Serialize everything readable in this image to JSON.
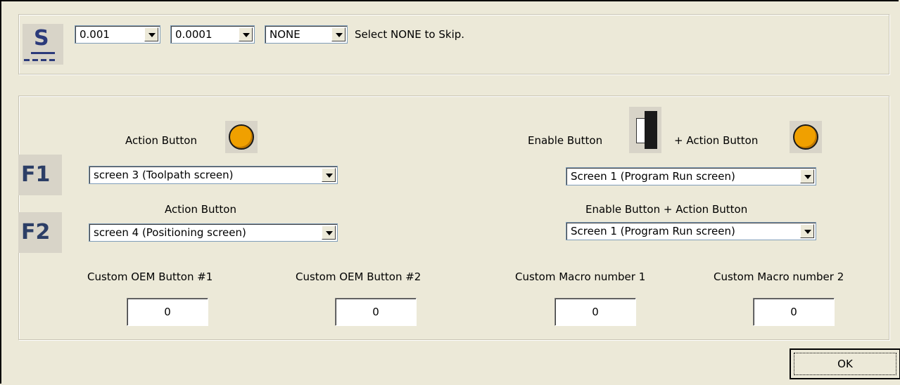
{
  "top_section": {
    "combo1": {
      "value": "0.001"
    },
    "combo2": {
      "value": "0.0001"
    },
    "combo3": {
      "value": "NONE"
    },
    "hint": "Select NONE to Skip."
  },
  "s_icon": {
    "letter": "S"
  },
  "f1": {
    "key": "F1",
    "action_label": "Action Button",
    "enable_label": "Enable Button",
    "plus_action_label": "+ Action Button",
    "action_select": "screen 3 (Toolpath screen)",
    "enable_select": "Screen 1 (Program Run screen)"
  },
  "f2": {
    "key": "F2",
    "action_label": "Action Button",
    "enable_label": "Enable Button + Action Button",
    "action_select": "screen 4 (Positioning screen)",
    "enable_select": "Screen 1 (Program Run screen)"
  },
  "custom": {
    "oem1": {
      "label": "Custom OEM Button #1",
      "value": "0"
    },
    "oem2": {
      "label": "Custom OEM Button #2",
      "value": "0"
    },
    "macro1": {
      "label": "Custom Macro number 1",
      "value": "0"
    },
    "macro2": {
      "label": "Custom Macro number 2",
      "value": "0"
    }
  },
  "ok_button": {
    "label": "OK"
  },
  "colors": {
    "orange": "#f0a000",
    "icon_blue": "#2b3a7a",
    "dialog_bg": "#ece9d8"
  }
}
